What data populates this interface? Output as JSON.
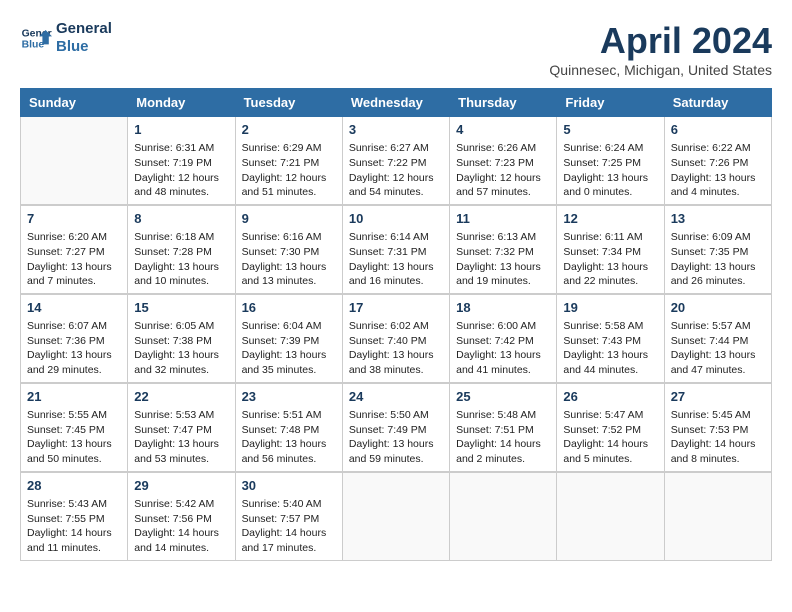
{
  "header": {
    "logo_line1": "General",
    "logo_line2": "Blue",
    "month_year": "April 2024",
    "location": "Quinnesec, Michigan, United States"
  },
  "days_of_week": [
    "Sunday",
    "Monday",
    "Tuesday",
    "Wednesday",
    "Thursday",
    "Friday",
    "Saturday"
  ],
  "weeks": [
    [
      {
        "day": "",
        "info": ""
      },
      {
        "day": "1",
        "info": "Sunrise: 6:31 AM\nSunset: 7:19 PM\nDaylight: 12 hours\nand 48 minutes."
      },
      {
        "day": "2",
        "info": "Sunrise: 6:29 AM\nSunset: 7:21 PM\nDaylight: 12 hours\nand 51 minutes."
      },
      {
        "day": "3",
        "info": "Sunrise: 6:27 AM\nSunset: 7:22 PM\nDaylight: 12 hours\nand 54 minutes."
      },
      {
        "day": "4",
        "info": "Sunrise: 6:26 AM\nSunset: 7:23 PM\nDaylight: 12 hours\nand 57 minutes."
      },
      {
        "day": "5",
        "info": "Sunrise: 6:24 AM\nSunset: 7:25 PM\nDaylight: 13 hours\nand 0 minutes."
      },
      {
        "day": "6",
        "info": "Sunrise: 6:22 AM\nSunset: 7:26 PM\nDaylight: 13 hours\nand 4 minutes."
      }
    ],
    [
      {
        "day": "7",
        "info": "Sunrise: 6:20 AM\nSunset: 7:27 PM\nDaylight: 13 hours\nand 7 minutes."
      },
      {
        "day": "8",
        "info": "Sunrise: 6:18 AM\nSunset: 7:28 PM\nDaylight: 13 hours\nand 10 minutes."
      },
      {
        "day": "9",
        "info": "Sunrise: 6:16 AM\nSunset: 7:30 PM\nDaylight: 13 hours\nand 13 minutes."
      },
      {
        "day": "10",
        "info": "Sunrise: 6:14 AM\nSunset: 7:31 PM\nDaylight: 13 hours\nand 16 minutes."
      },
      {
        "day": "11",
        "info": "Sunrise: 6:13 AM\nSunset: 7:32 PM\nDaylight: 13 hours\nand 19 minutes."
      },
      {
        "day": "12",
        "info": "Sunrise: 6:11 AM\nSunset: 7:34 PM\nDaylight: 13 hours\nand 22 minutes."
      },
      {
        "day": "13",
        "info": "Sunrise: 6:09 AM\nSunset: 7:35 PM\nDaylight: 13 hours\nand 26 minutes."
      }
    ],
    [
      {
        "day": "14",
        "info": "Sunrise: 6:07 AM\nSunset: 7:36 PM\nDaylight: 13 hours\nand 29 minutes."
      },
      {
        "day": "15",
        "info": "Sunrise: 6:05 AM\nSunset: 7:38 PM\nDaylight: 13 hours\nand 32 minutes."
      },
      {
        "day": "16",
        "info": "Sunrise: 6:04 AM\nSunset: 7:39 PM\nDaylight: 13 hours\nand 35 minutes."
      },
      {
        "day": "17",
        "info": "Sunrise: 6:02 AM\nSunset: 7:40 PM\nDaylight: 13 hours\nand 38 minutes."
      },
      {
        "day": "18",
        "info": "Sunrise: 6:00 AM\nSunset: 7:42 PM\nDaylight: 13 hours\nand 41 minutes."
      },
      {
        "day": "19",
        "info": "Sunrise: 5:58 AM\nSunset: 7:43 PM\nDaylight: 13 hours\nand 44 minutes."
      },
      {
        "day": "20",
        "info": "Sunrise: 5:57 AM\nSunset: 7:44 PM\nDaylight: 13 hours\nand 47 minutes."
      }
    ],
    [
      {
        "day": "21",
        "info": "Sunrise: 5:55 AM\nSunset: 7:45 PM\nDaylight: 13 hours\nand 50 minutes."
      },
      {
        "day": "22",
        "info": "Sunrise: 5:53 AM\nSunset: 7:47 PM\nDaylight: 13 hours\nand 53 minutes."
      },
      {
        "day": "23",
        "info": "Sunrise: 5:51 AM\nSunset: 7:48 PM\nDaylight: 13 hours\nand 56 minutes."
      },
      {
        "day": "24",
        "info": "Sunrise: 5:50 AM\nSunset: 7:49 PM\nDaylight: 13 hours\nand 59 minutes."
      },
      {
        "day": "25",
        "info": "Sunrise: 5:48 AM\nSunset: 7:51 PM\nDaylight: 14 hours\nand 2 minutes."
      },
      {
        "day": "26",
        "info": "Sunrise: 5:47 AM\nSunset: 7:52 PM\nDaylight: 14 hours\nand 5 minutes."
      },
      {
        "day": "27",
        "info": "Sunrise: 5:45 AM\nSunset: 7:53 PM\nDaylight: 14 hours\nand 8 minutes."
      }
    ],
    [
      {
        "day": "28",
        "info": "Sunrise: 5:43 AM\nSunset: 7:55 PM\nDaylight: 14 hours\nand 11 minutes."
      },
      {
        "day": "29",
        "info": "Sunrise: 5:42 AM\nSunset: 7:56 PM\nDaylight: 14 hours\nand 14 minutes."
      },
      {
        "day": "30",
        "info": "Sunrise: 5:40 AM\nSunset: 7:57 PM\nDaylight: 14 hours\nand 17 minutes."
      },
      {
        "day": "",
        "info": ""
      },
      {
        "day": "",
        "info": ""
      },
      {
        "day": "",
        "info": ""
      },
      {
        "day": "",
        "info": ""
      }
    ]
  ]
}
